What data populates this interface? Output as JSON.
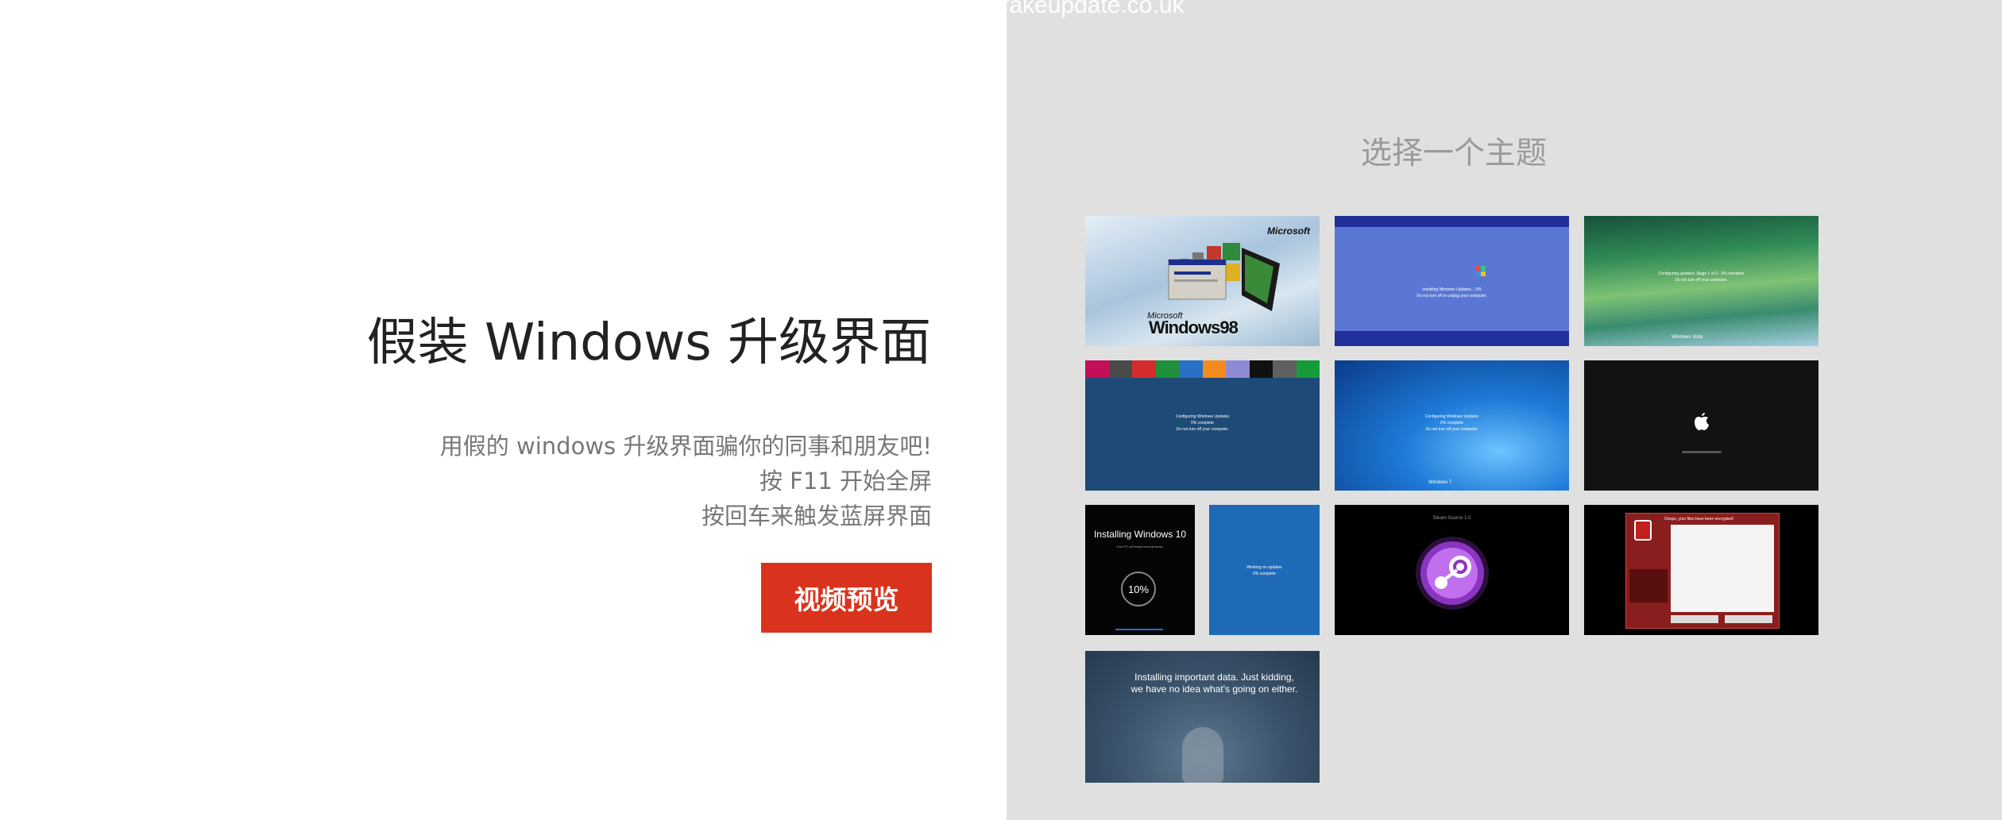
{
  "topbar": {
    "domain": "fakeupdate.co.uk"
  },
  "hero": {
    "title": "假装 Windows 升级界面",
    "lines": [
      "用假的 windows 升级界面骗你的同事和朋友吧!",
      "按 F11 开始全屏",
      "按回车来触发蓝屏界面"
    ],
    "video_button": "视频预览",
    "button_color": "#d9331e"
  },
  "themes": {
    "heading": "选择一个主题",
    "win98": {
      "brand_top": "Microsoft",
      "brand_small": "Microsoft",
      "brand": "Windows98"
    },
    "xp": {
      "line1": "Installing Windows Updates... 0%",
      "line2": "Do not turn off or unplug your computer."
    },
    "vista": {
      "line1": "Configuring updates: Stage 1 of 3 · 0% complete",
      "line2": "Do not turn off your computer.",
      "footer": "Windows Vista"
    },
    "win8": {
      "line1": "Configuring Windows Updates",
      "line2": "0% complete",
      "line3": "Do not turn off your computer."
    },
    "win7": {
      "line1": "Configuring Windows Updates",
      "line2": "0% complete",
      "line3": "Do not turn off your computer.",
      "footer": "Windows 7"
    },
    "win10": {
      "title": "Installing Windows 10",
      "sub": "Your PC will restart several times.",
      "percent": "10%"
    },
    "win10blue": {
      "line1": "Working on updates",
      "line2": "0% complete"
    },
    "steam": {
      "header": "Steam Source 1.0"
    },
    "ransom": {
      "title": "Ooops, your files have been encrypted!"
    },
    "hacker": {
      "text": "Installing important data. Just kidding, we have no idea what's going on either."
    }
  }
}
